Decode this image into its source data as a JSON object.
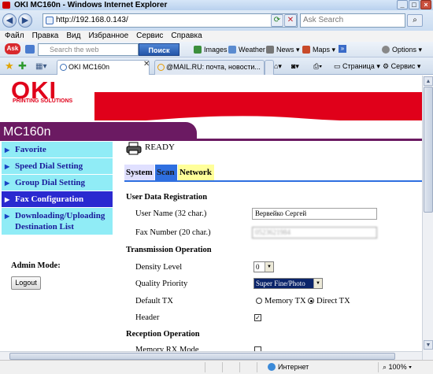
{
  "window": {
    "title": "OKI MC160n - Windows Internet Explorer"
  },
  "address": {
    "url": "http://192.168.0.143/",
    "search_placeholder": "Ask Search"
  },
  "menu": [
    "Файл",
    "Правка",
    "Вид",
    "Избранное",
    "Сервис",
    "Справка"
  ],
  "toolbar": {
    "search_placeholder": "Search the web",
    "search_button": "Поиск",
    "items": [
      "Images",
      "Weather",
      "News",
      "Maps"
    ],
    "options": "Options"
  },
  "tabs": {
    "tab1": "OKI MC160n",
    "tab2": "@MAIL.RU: почта, новости...",
    "page_menu": "Страница",
    "service_menu": "Сервис"
  },
  "oki": {
    "logo": "OKI",
    "tagline": "PRINTING SOLUTIONS",
    "model": "MC160n",
    "status": "READY"
  },
  "nav": {
    "items": [
      "Favorite",
      "Speed Dial Setting",
      "Group Dial Setting",
      "Fax Configuration",
      "Downloading/Uploading Destination List"
    ],
    "admin_label": "Admin Mode:",
    "logout": "Logout"
  },
  "config_tabs": [
    "System",
    "Scan",
    "Network"
  ],
  "form": {
    "user_section": "User Data Registration",
    "user_name_label": "User Name (32 char.)",
    "user_name_value": "Вервейко Сергей",
    "fax_number_label": "Fax Number (20 char.)",
    "fax_number_value": "0523621984",
    "tx_section": "Transmission Operation",
    "density_label": "Density Level",
    "density_value": "0",
    "quality_label": "Quality Priority",
    "quality_value": "Super Fine/Photo",
    "default_tx_label": "Default TX",
    "memory_tx": "Memory TX",
    "direct_tx": "Direct TX",
    "header_label": "Header",
    "rx_section": "Reception Operation",
    "memory_rx_label": "Memory RX Mode"
  },
  "statusbar": {
    "zone": "Интернет",
    "zoom": "100%"
  }
}
